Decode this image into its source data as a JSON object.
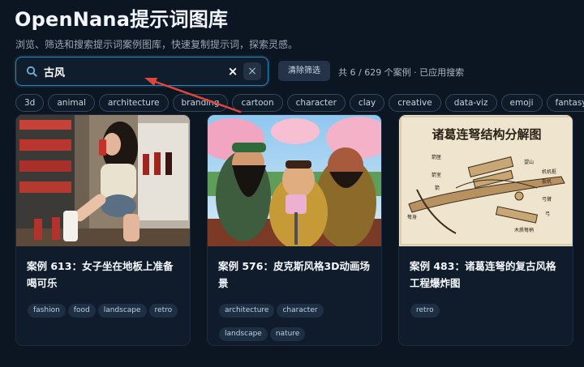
{
  "header": {
    "title": "OpenNana提示词图库",
    "subtitle": "浏览、筛选和搜索提示词案例图库，快速复制提示词，探索灵感。"
  },
  "search": {
    "value": "古风",
    "clear_icon": "×",
    "clear_button_icon": "×",
    "reset_label": "清除筛选",
    "result_text": "共 6 / 629 个案例 · 已应用搜索"
  },
  "filter_tags": [
    "3d",
    "animal",
    "architecture",
    "branding",
    "cartoon",
    "character",
    "clay",
    "creative",
    "data-viz",
    "emoji",
    "fantasy"
  ],
  "cards": [
    {
      "title": "案例 613：女子坐在地板上准备喝可乐",
      "tags": [
        "fashion",
        "food",
        "landscape",
        "retro"
      ],
      "image": "woman-drinking-cola-photo"
    },
    {
      "title": "案例 576：皮克斯风格3D动画场景",
      "tags": [
        "architecture",
        "character",
        "landscape",
        "nature"
      ],
      "image": "pixar-3d-three-kingdoms-heroes"
    },
    {
      "title": "案例 483：诸葛连弩的复古风格工程爆炸图",
      "tags": [
        "retro"
      ],
      "image": "crossbow-exploded-diagram"
    }
  ],
  "diagram": {
    "title": "诸葛连弩结构分解图",
    "labels": [
      "箭匣",
      "箭室",
      "箭",
      "弩身",
      "望山",
      "机机枢",
      "扳机",
      "弓臂",
      "弓",
      "木质弩柄"
    ]
  },
  "colors": {
    "background": "#0c1522",
    "accent": "#2f86b8",
    "annotation_arrow": "#e0473c"
  }
}
